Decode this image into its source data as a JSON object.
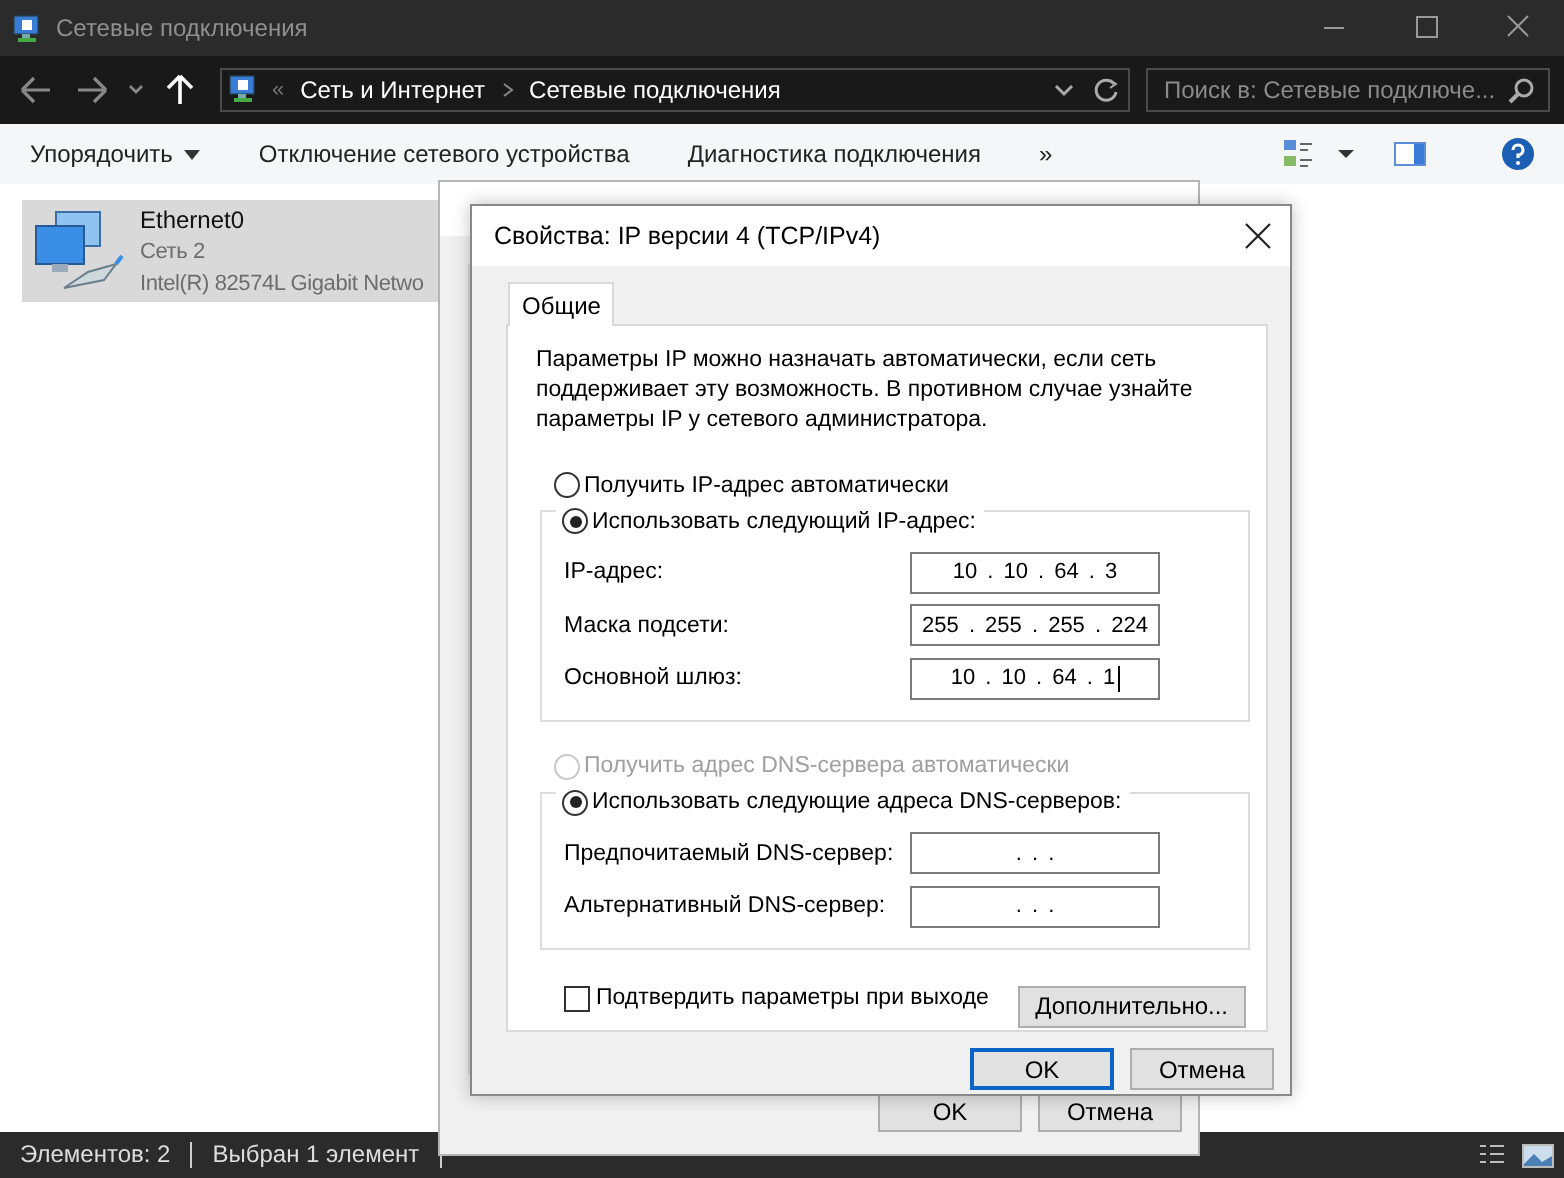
{
  "window": {
    "title": "Сетевые подключения"
  },
  "address_bar": {
    "overflow": "«",
    "breadcrumbs": [
      "Сеть и Интернет",
      "Сетевые подключения"
    ],
    "search": {
      "placeholder": "Поиск в: Сетевые подключе..."
    }
  },
  "toolbar": {
    "items": [
      {
        "label": "Упорядочить",
        "dropdown": true
      },
      {
        "label": "Отключение сетевого устройства",
        "dropdown": false
      },
      {
        "label": "Диагностика подключения",
        "dropdown": false
      },
      {
        "label": "»",
        "dropdown": false
      }
    ]
  },
  "connections": [
    {
      "name": "Ethernet0",
      "network": "Сеть 2",
      "adapter": "Intel(R) 82574L Gigabit Netwo",
      "selected": true
    }
  ],
  "back_dialog": {
    "buttons": [
      "OK",
      "Отмена"
    ]
  },
  "dialog": {
    "title": "Свойства: IP версии 4 (TCP/IPv4)",
    "tabs": [
      {
        "label": "Общие",
        "selected": true
      }
    ],
    "description": "Параметры IP можно назначать автоматически, если сеть поддерживает эту возможность. В противном случае узнайте параметры IP у сетевого администратора.",
    "ip_options": [
      {
        "label": "Получить IP-адрес автоматически",
        "selected": false,
        "disabled": false
      },
      {
        "label": "Использовать следующий IP-адрес:",
        "selected": true,
        "disabled": false
      }
    ],
    "ip_fields": [
      {
        "label": "IP-адрес:",
        "value": "10 . 10 . 64 . 3",
        "focused": false
      },
      {
        "label": "Маска подсети:",
        "value": "255 . 255 . 255 . 224",
        "focused": false
      },
      {
        "label": "Основной шлюз:",
        "value": "10 . 10 . 64 . 1",
        "focused": true
      }
    ],
    "dns_options": [
      {
        "label": "Получить адрес DNS-сервера автоматически",
        "selected": false,
        "disabled": true
      },
      {
        "label": "Использовать следующие адреса DNS-серверов:",
        "selected": true,
        "disabled": false
      }
    ],
    "dns_fields": [
      {
        "label": "Предпочитаемый DNS-сервер:",
        "value": ". . .",
        "focused": false
      },
      {
        "label": "Альтернативный DNS-сервер:",
        "value": ". . .",
        "focused": false
      }
    ],
    "confirm": {
      "label": "Подтвердить параметры при выходе",
      "checked": false
    },
    "advanced_button": "Дополнительно...",
    "buttons": [
      {
        "label": "OK",
        "default": true
      },
      {
        "label": "Отмена",
        "default": false
      }
    ]
  },
  "status_bar": [
    "Элементов: 2",
    "Выбран 1 элемент"
  ]
}
